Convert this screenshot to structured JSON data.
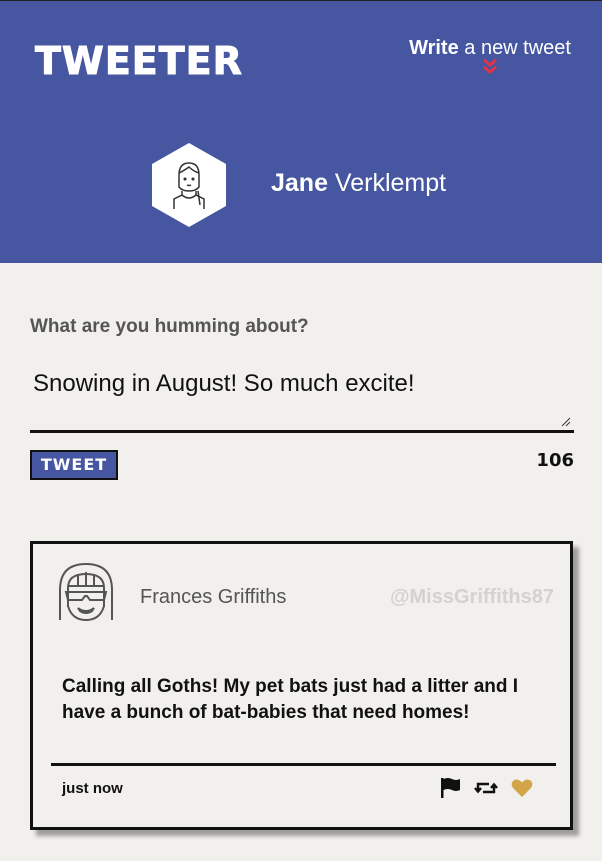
{
  "app": {
    "brand": "TWEETER"
  },
  "header": {
    "compose_toggle": {
      "bold": "Write",
      "rest": " a new tweet"
    },
    "user": {
      "first_name": "Jane",
      "last_name": " Verklempt"
    }
  },
  "composer": {
    "prompt": "What are you humming about?",
    "text": "Snowing in August! So much excite!",
    "button_label": "TWEET",
    "char_count": "106"
  },
  "tweets": [
    {
      "name": "Frances Griffiths",
      "handle": "@MissGriffiths87",
      "text": "Calling all Goths! My pet bats just had a litter and I have a bunch of bat-babies that need homes!",
      "time": "just now",
      "actions": [
        "flag-icon",
        "retweet-icon",
        "heart-icon"
      ]
    }
  ],
  "colors": {
    "header_bg": "#4656a0",
    "accent_red": "#e0344a",
    "heart": "#d1a548",
    "page_bg": "#f2f0ec"
  }
}
